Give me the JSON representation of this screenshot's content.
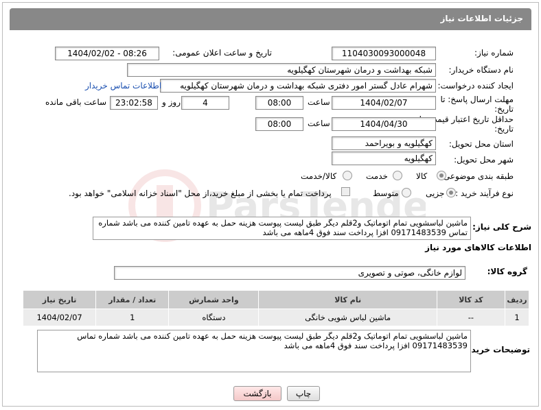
{
  "header": {
    "title": "جزئیات اطلاعات نیاز"
  },
  "fields": {
    "need_number_label": "شماره نیاز:",
    "need_number": "1104030093000048",
    "announce_label": "تاریخ و ساعت اعلان عمومی:",
    "announce_value": "1404/02/02 - 08:26",
    "buyer_label": "نام دستگاه خریدار:",
    "buyer_value": "شبکه بهداشت و درمان شهرستان کهگیلویه",
    "creator_label": "ایجاد کننده درخواست:",
    "creator_value": "شهرام عادل گستر امور دفتری شبکه بهداشت و درمان شهرستان کهگیلویه",
    "contact_link": "اطلاعات تماس خریدار",
    "deadline_label": "مهلت ارسال پاسخ: تا تاریخ:",
    "deadline_date": "1404/02/07",
    "time_label": "ساعت",
    "deadline_time": "08:00",
    "days_value": "4",
    "days_label": "روز و",
    "remaining_value": "23:02:58",
    "remaining_label": "ساعت باقی مانده",
    "validity_label": "حداقل تاریخ اعتبار قیمت: تا تاریخ:",
    "validity_date": "1404/04/30",
    "validity_time": "08:00",
    "province_label": "استان محل تحویل:",
    "province_value": "کهگیلویه و بویراحمد",
    "city_label": "شهر محل تحویل:",
    "city_value": "کهگیلویه",
    "category_label": "طبقه بندی موضوعی:",
    "category_options": [
      "کالا",
      "خدمت",
      "کالا/خدمت"
    ],
    "process_label": "نوع فرآیند خرید :",
    "process_options": [
      "جزیی",
      "متوسط"
    ],
    "payment_note": "پرداخت تمام یا بخشی از مبلغ خرید،از محل \"اسناد خزانه اسلامی\" خواهد بود."
  },
  "description": {
    "label": "شرح کلی نیاز:",
    "text": "ماشین لباسشویی تمام اتوماتیک و2قلم دیگر طبق لیست پیوست هزینه حمل به عهده تامین کننده می باشد شماره تماس 09171483539  افزا پرداخت سند فوق 4ماهه می باشد"
  },
  "goods_info": {
    "title": "اطلاعات کالاهای مورد نیاز",
    "group_label": "گروه کالا:",
    "group_value": "لوازم خانگی، صوتی و تصویری"
  },
  "table": {
    "headers": [
      "ردیف",
      "کد کالا",
      "نام کالا",
      "واحد شمارش",
      "تعداد / مقدار",
      "تاریخ نیاز"
    ],
    "rows": [
      [
        "1",
        "--",
        "ماشین لباس شویی خانگی",
        "دستگاه",
        "1",
        "1404/02/07"
      ]
    ]
  },
  "buyer_notes": {
    "label": "توضیحات خریدار:",
    "text": "ماشین لباسشویی تمام اتوماتیک و2قلم دیگر طبق لیست پیوست هزینه حمل به عهده تامین کننده می باشد شماره تماس 09171483539  افزا پرداخت سند فوق 4ماهه می باشد"
  },
  "buttons": {
    "print": "چاپ",
    "back": "بازگشت"
  },
  "colors": {
    "header_bg": "#888888",
    "link": "#1a4fb0",
    "table_header": "#cccccc",
    "table_row": "#ececec"
  }
}
